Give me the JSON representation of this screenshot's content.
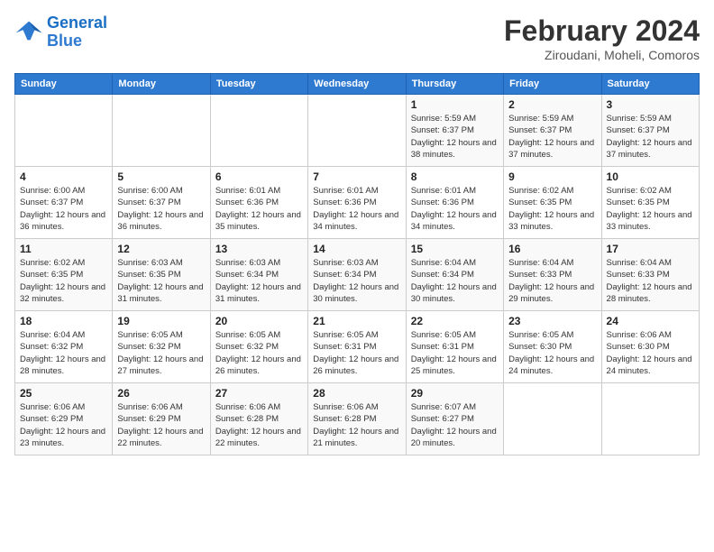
{
  "header": {
    "logo_line1": "General",
    "logo_line2": "Blue",
    "month_year": "February 2024",
    "location": "Ziroudani, Moheli, Comoros"
  },
  "days_of_week": [
    "Sunday",
    "Monday",
    "Tuesday",
    "Wednesday",
    "Thursday",
    "Friday",
    "Saturday"
  ],
  "weeks": [
    [
      {
        "day": "",
        "detail": ""
      },
      {
        "day": "",
        "detail": ""
      },
      {
        "day": "",
        "detail": ""
      },
      {
        "day": "",
        "detail": ""
      },
      {
        "day": "1",
        "detail": "Sunrise: 5:59 AM\nSunset: 6:37 PM\nDaylight: 12 hours\nand 38 minutes."
      },
      {
        "day": "2",
        "detail": "Sunrise: 5:59 AM\nSunset: 6:37 PM\nDaylight: 12 hours\nand 37 minutes."
      },
      {
        "day": "3",
        "detail": "Sunrise: 5:59 AM\nSunset: 6:37 PM\nDaylight: 12 hours\nand 37 minutes."
      }
    ],
    [
      {
        "day": "4",
        "detail": "Sunrise: 6:00 AM\nSunset: 6:37 PM\nDaylight: 12 hours\nand 36 minutes."
      },
      {
        "day": "5",
        "detail": "Sunrise: 6:00 AM\nSunset: 6:37 PM\nDaylight: 12 hours\nand 36 minutes."
      },
      {
        "day": "6",
        "detail": "Sunrise: 6:01 AM\nSunset: 6:36 PM\nDaylight: 12 hours\nand 35 minutes."
      },
      {
        "day": "7",
        "detail": "Sunrise: 6:01 AM\nSunset: 6:36 PM\nDaylight: 12 hours\nand 34 minutes."
      },
      {
        "day": "8",
        "detail": "Sunrise: 6:01 AM\nSunset: 6:36 PM\nDaylight: 12 hours\nand 34 minutes."
      },
      {
        "day": "9",
        "detail": "Sunrise: 6:02 AM\nSunset: 6:35 PM\nDaylight: 12 hours\nand 33 minutes."
      },
      {
        "day": "10",
        "detail": "Sunrise: 6:02 AM\nSunset: 6:35 PM\nDaylight: 12 hours\nand 33 minutes."
      }
    ],
    [
      {
        "day": "11",
        "detail": "Sunrise: 6:02 AM\nSunset: 6:35 PM\nDaylight: 12 hours\nand 32 minutes."
      },
      {
        "day": "12",
        "detail": "Sunrise: 6:03 AM\nSunset: 6:35 PM\nDaylight: 12 hours\nand 31 minutes."
      },
      {
        "day": "13",
        "detail": "Sunrise: 6:03 AM\nSunset: 6:34 PM\nDaylight: 12 hours\nand 31 minutes."
      },
      {
        "day": "14",
        "detail": "Sunrise: 6:03 AM\nSunset: 6:34 PM\nDaylight: 12 hours\nand 30 minutes."
      },
      {
        "day": "15",
        "detail": "Sunrise: 6:04 AM\nSunset: 6:34 PM\nDaylight: 12 hours\nand 30 minutes."
      },
      {
        "day": "16",
        "detail": "Sunrise: 6:04 AM\nSunset: 6:33 PM\nDaylight: 12 hours\nand 29 minutes."
      },
      {
        "day": "17",
        "detail": "Sunrise: 6:04 AM\nSunset: 6:33 PM\nDaylight: 12 hours\nand 28 minutes."
      }
    ],
    [
      {
        "day": "18",
        "detail": "Sunrise: 6:04 AM\nSunset: 6:32 PM\nDaylight: 12 hours\nand 28 minutes."
      },
      {
        "day": "19",
        "detail": "Sunrise: 6:05 AM\nSunset: 6:32 PM\nDaylight: 12 hours\nand 27 minutes."
      },
      {
        "day": "20",
        "detail": "Sunrise: 6:05 AM\nSunset: 6:32 PM\nDaylight: 12 hours\nand 26 minutes."
      },
      {
        "day": "21",
        "detail": "Sunrise: 6:05 AM\nSunset: 6:31 PM\nDaylight: 12 hours\nand 26 minutes."
      },
      {
        "day": "22",
        "detail": "Sunrise: 6:05 AM\nSunset: 6:31 PM\nDaylight: 12 hours\nand 25 minutes."
      },
      {
        "day": "23",
        "detail": "Sunrise: 6:05 AM\nSunset: 6:30 PM\nDaylight: 12 hours\nand 24 minutes."
      },
      {
        "day": "24",
        "detail": "Sunrise: 6:06 AM\nSunset: 6:30 PM\nDaylight: 12 hours\nand 24 minutes."
      }
    ],
    [
      {
        "day": "25",
        "detail": "Sunrise: 6:06 AM\nSunset: 6:29 PM\nDaylight: 12 hours\nand 23 minutes."
      },
      {
        "day": "26",
        "detail": "Sunrise: 6:06 AM\nSunset: 6:29 PM\nDaylight: 12 hours\nand 22 minutes."
      },
      {
        "day": "27",
        "detail": "Sunrise: 6:06 AM\nSunset: 6:28 PM\nDaylight: 12 hours\nand 22 minutes."
      },
      {
        "day": "28",
        "detail": "Sunrise: 6:06 AM\nSunset: 6:28 PM\nDaylight: 12 hours\nand 21 minutes."
      },
      {
        "day": "29",
        "detail": "Sunrise: 6:07 AM\nSunset: 6:27 PM\nDaylight: 12 hours\nand 20 minutes."
      },
      {
        "day": "",
        "detail": ""
      },
      {
        "day": "",
        "detail": ""
      }
    ]
  ]
}
